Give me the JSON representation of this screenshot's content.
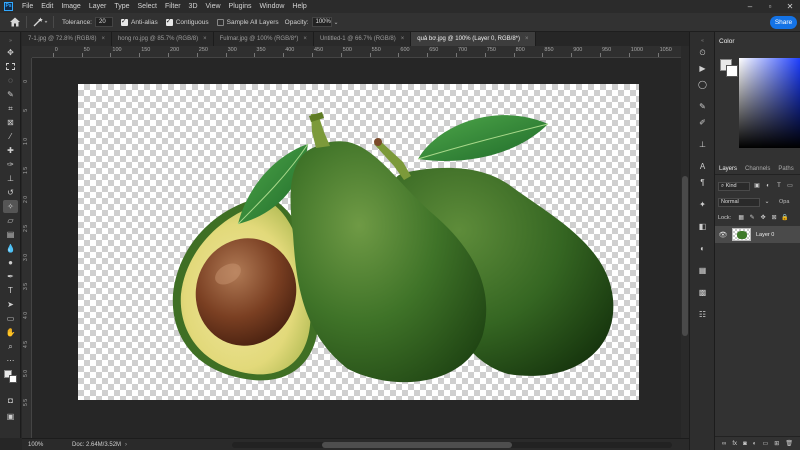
{
  "menu": {
    "app_badge": "Ps",
    "items": [
      "File",
      "Edit",
      "Image",
      "Layer",
      "Type",
      "Select",
      "Filter",
      "3D",
      "View",
      "Plugins",
      "Window",
      "Help"
    ]
  },
  "options_bar": {
    "tolerance_label": "Tolerance:",
    "tolerance_value": "20",
    "anti_alias_label": "Anti-alias",
    "anti_alias_checked": true,
    "contiguous_label": "Contiguous",
    "contiguous_checked": true,
    "sample_all_label": "Sample All Layers",
    "sample_all_checked": false,
    "opacity_label": "Opacity:",
    "opacity_value": "100%",
    "share_label": "Share"
  },
  "tabs": [
    {
      "label": "7-1.jpg @ 72.8% (RGB/8)",
      "close": "×",
      "active": false
    },
    {
      "label": "hong ro.jpg @ 85.7% (RGB/8)",
      "close": "×",
      "active": false
    },
    {
      "label": "Fulmar.jpg @ 100% (RGB/8*)",
      "close": "×",
      "active": false
    },
    {
      "label": "Untitled-1 @ 66.7% (RGB/8)",
      "close": "×",
      "active": false
    },
    {
      "label": "quả bơ.jpg @ 100% (Layer 0, RGB/8*)",
      "close": "×",
      "active": true
    }
  ],
  "ruler": {
    "top_labels": [
      "50",
      "0",
      "50",
      "100",
      "150",
      "200",
      "250",
      "300",
      "350",
      "400",
      "450",
      "500",
      "550",
      "600",
      "650",
      "700",
      "750",
      "800",
      "850",
      "900",
      "950",
      "1000",
      "1050"
    ],
    "left_labels": [
      "0",
      "5",
      "1 0",
      "1 5",
      "2 0",
      "2 5",
      "3 0",
      "3 5",
      "4 0",
      "4 5",
      "5 0",
      "5 5"
    ]
  },
  "status": {
    "zoom": "100%",
    "doc": "Doc: 2.64M/3.52M"
  },
  "panels": {
    "color_tab": "Color",
    "fg_color": "#e8e8e8",
    "bg_color": "#ffffff",
    "layers_tabs": [
      "Layers",
      "Channels",
      "Paths"
    ],
    "kind_label": "Kind",
    "blend_mode": "Normal",
    "opacity_short": "Opa",
    "lock_label": "Lock:",
    "layer_name": "Layer 0"
  },
  "tools": [
    "move-icon",
    "marquee-icon",
    "lasso-icon",
    "quick-select-icon",
    "crop-icon",
    "frame-icon",
    "eyedropper-icon",
    "healing-icon",
    "brush-icon",
    "stamp-icon",
    "history-brush-icon",
    "eraser-icon",
    "gradient-icon",
    "blur-icon",
    "dodge-icon",
    "pen-icon",
    "type-icon",
    "path-select-icon",
    "shape-icon",
    "hand-icon",
    "zoom-icon",
    "more-tools-icon",
    "swap-colors-icon",
    "color-swatch-icon",
    "quick-mask-icon",
    "screen-mode-icon"
  ]
}
